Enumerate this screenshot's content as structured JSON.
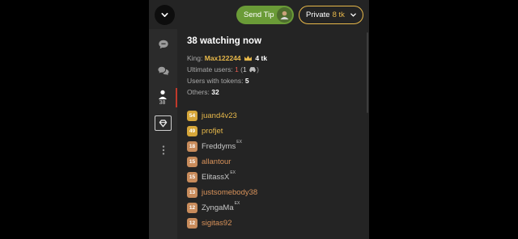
{
  "header": {
    "send_tip_label": "Send Tip",
    "private_label": "Private",
    "private_price": "8 tk"
  },
  "sidebar": {
    "users_count": "38"
  },
  "panel": {
    "heading": "38 watching now",
    "king_label": "King:",
    "king_name": "Max122244",
    "king_tokens": "4 tk",
    "ultimate_label": "Ultimate users:",
    "ultimate_count": "1",
    "ultimate_paren_count": "1",
    "tokens_label": "Users with tokens:",
    "tokens_count": "5",
    "others_label": "Others:",
    "others_count": "32"
  },
  "users": [
    {
      "level": "54",
      "name": "juand4v23",
      "tier": "gold",
      "ex": ""
    },
    {
      "level": "49",
      "name": "profjet",
      "tier": "gold",
      "ex": ""
    },
    {
      "level": "18",
      "name": "Freddyms",
      "tier": "bronze",
      "ex": "EX"
    },
    {
      "level": "15",
      "name": "allantour",
      "tier": "bronze",
      "ex": ""
    },
    {
      "level": "15",
      "name": "ElitassX",
      "tier": "bronze",
      "ex": "EX"
    },
    {
      "level": "13",
      "name": "justsomebody38",
      "tier": "bronze",
      "ex": ""
    },
    {
      "level": "12",
      "name": "ZyngaMa",
      "tier": "bronze",
      "ex": "EX"
    },
    {
      "level": "12",
      "name": "sigitas92",
      "tier": "bronze",
      "ex": ""
    }
  ],
  "colors": {
    "accent_gold": "#e7b84a",
    "tip_green": "#6a9b37",
    "panel_bg": "#242424",
    "ultimate_red": "#e05a4f"
  },
  "icons": [
    "chevron-down-icon",
    "chat-bubble-icon",
    "chat-bubbles-icon",
    "user-icon",
    "diamond-icon",
    "more-vertical-icon",
    "crown-icon",
    "car-icon"
  ]
}
